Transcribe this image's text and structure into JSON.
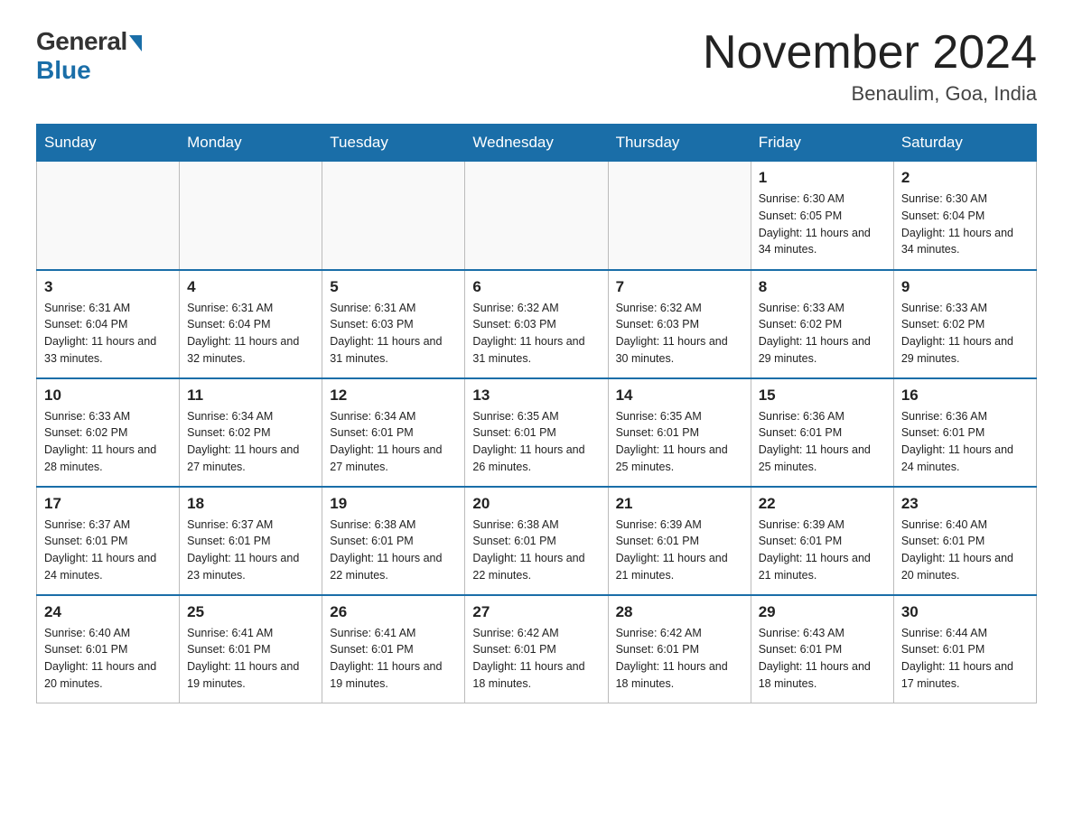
{
  "header": {
    "logo_general": "General",
    "logo_blue": "Blue",
    "month_year": "November 2024",
    "location": "Benaulim, Goa, India"
  },
  "calendar": {
    "days_of_week": [
      "Sunday",
      "Monday",
      "Tuesday",
      "Wednesday",
      "Thursday",
      "Friday",
      "Saturday"
    ],
    "weeks": [
      [
        {
          "day": "",
          "info": ""
        },
        {
          "day": "",
          "info": ""
        },
        {
          "day": "",
          "info": ""
        },
        {
          "day": "",
          "info": ""
        },
        {
          "day": "",
          "info": ""
        },
        {
          "day": "1",
          "info": "Sunrise: 6:30 AM\nSunset: 6:05 PM\nDaylight: 11 hours and 34 minutes."
        },
        {
          "day": "2",
          "info": "Sunrise: 6:30 AM\nSunset: 6:04 PM\nDaylight: 11 hours and 34 minutes."
        }
      ],
      [
        {
          "day": "3",
          "info": "Sunrise: 6:31 AM\nSunset: 6:04 PM\nDaylight: 11 hours and 33 minutes."
        },
        {
          "day": "4",
          "info": "Sunrise: 6:31 AM\nSunset: 6:04 PM\nDaylight: 11 hours and 32 minutes."
        },
        {
          "day": "5",
          "info": "Sunrise: 6:31 AM\nSunset: 6:03 PM\nDaylight: 11 hours and 31 minutes."
        },
        {
          "day": "6",
          "info": "Sunrise: 6:32 AM\nSunset: 6:03 PM\nDaylight: 11 hours and 31 minutes."
        },
        {
          "day": "7",
          "info": "Sunrise: 6:32 AM\nSunset: 6:03 PM\nDaylight: 11 hours and 30 minutes."
        },
        {
          "day": "8",
          "info": "Sunrise: 6:33 AM\nSunset: 6:02 PM\nDaylight: 11 hours and 29 minutes."
        },
        {
          "day": "9",
          "info": "Sunrise: 6:33 AM\nSunset: 6:02 PM\nDaylight: 11 hours and 29 minutes."
        }
      ],
      [
        {
          "day": "10",
          "info": "Sunrise: 6:33 AM\nSunset: 6:02 PM\nDaylight: 11 hours and 28 minutes."
        },
        {
          "day": "11",
          "info": "Sunrise: 6:34 AM\nSunset: 6:02 PM\nDaylight: 11 hours and 27 minutes."
        },
        {
          "day": "12",
          "info": "Sunrise: 6:34 AM\nSunset: 6:01 PM\nDaylight: 11 hours and 27 minutes."
        },
        {
          "day": "13",
          "info": "Sunrise: 6:35 AM\nSunset: 6:01 PM\nDaylight: 11 hours and 26 minutes."
        },
        {
          "day": "14",
          "info": "Sunrise: 6:35 AM\nSunset: 6:01 PM\nDaylight: 11 hours and 25 minutes."
        },
        {
          "day": "15",
          "info": "Sunrise: 6:36 AM\nSunset: 6:01 PM\nDaylight: 11 hours and 25 minutes."
        },
        {
          "day": "16",
          "info": "Sunrise: 6:36 AM\nSunset: 6:01 PM\nDaylight: 11 hours and 24 minutes."
        }
      ],
      [
        {
          "day": "17",
          "info": "Sunrise: 6:37 AM\nSunset: 6:01 PM\nDaylight: 11 hours and 24 minutes."
        },
        {
          "day": "18",
          "info": "Sunrise: 6:37 AM\nSunset: 6:01 PM\nDaylight: 11 hours and 23 minutes."
        },
        {
          "day": "19",
          "info": "Sunrise: 6:38 AM\nSunset: 6:01 PM\nDaylight: 11 hours and 22 minutes."
        },
        {
          "day": "20",
          "info": "Sunrise: 6:38 AM\nSunset: 6:01 PM\nDaylight: 11 hours and 22 minutes."
        },
        {
          "day": "21",
          "info": "Sunrise: 6:39 AM\nSunset: 6:01 PM\nDaylight: 11 hours and 21 minutes."
        },
        {
          "day": "22",
          "info": "Sunrise: 6:39 AM\nSunset: 6:01 PM\nDaylight: 11 hours and 21 minutes."
        },
        {
          "day": "23",
          "info": "Sunrise: 6:40 AM\nSunset: 6:01 PM\nDaylight: 11 hours and 20 minutes."
        }
      ],
      [
        {
          "day": "24",
          "info": "Sunrise: 6:40 AM\nSunset: 6:01 PM\nDaylight: 11 hours and 20 minutes."
        },
        {
          "day": "25",
          "info": "Sunrise: 6:41 AM\nSunset: 6:01 PM\nDaylight: 11 hours and 19 minutes."
        },
        {
          "day": "26",
          "info": "Sunrise: 6:41 AM\nSunset: 6:01 PM\nDaylight: 11 hours and 19 minutes."
        },
        {
          "day": "27",
          "info": "Sunrise: 6:42 AM\nSunset: 6:01 PM\nDaylight: 11 hours and 18 minutes."
        },
        {
          "day": "28",
          "info": "Sunrise: 6:42 AM\nSunset: 6:01 PM\nDaylight: 11 hours and 18 minutes."
        },
        {
          "day": "29",
          "info": "Sunrise: 6:43 AM\nSunset: 6:01 PM\nDaylight: 11 hours and 18 minutes."
        },
        {
          "day": "30",
          "info": "Sunrise: 6:44 AM\nSunset: 6:01 PM\nDaylight: 11 hours and 17 minutes."
        }
      ]
    ]
  }
}
